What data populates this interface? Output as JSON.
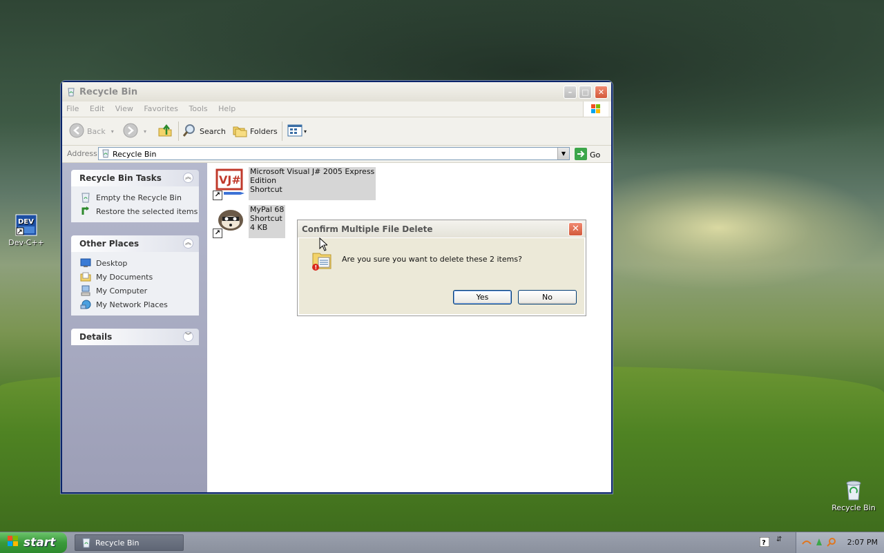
{
  "desktop": {
    "icons": [
      {
        "label": "Dev-C++",
        "icon": "devcpp-icon"
      },
      {
        "label": "Recycle Bin",
        "icon": "recycle-bin-icon"
      }
    ]
  },
  "window": {
    "title": "Recycle Bin",
    "menu": [
      "File",
      "Edit",
      "View",
      "Favorites",
      "Tools",
      "Help"
    ],
    "toolbar": {
      "back": "Back",
      "search": "Search",
      "folders": "Folders"
    },
    "address": {
      "label": "Address",
      "value": "Recycle Bin",
      "go": "Go"
    },
    "tasks_panel": {
      "title": "Recycle Bin Tasks",
      "items": [
        "Empty the Recycle Bin",
        "Restore the selected items"
      ]
    },
    "places_panel": {
      "title": "Other Places",
      "items": [
        "Desktop",
        "My Documents",
        "My Computer",
        "My Network Places"
      ]
    },
    "details_panel": {
      "title": "Details"
    },
    "files": [
      {
        "name_line1": "Microsoft Visual J# 2005 Express",
        "name_line2": "Edition",
        "type": "Shortcut",
        "size": ""
      },
      {
        "name_line1": "MyPal 68",
        "name_line2": "",
        "type": "Shortcut",
        "size": "4 KB"
      }
    ]
  },
  "dialog": {
    "title": "Confirm Multiple File Delete",
    "message": "Are you sure you want to delete these 2 items?",
    "yes": "Yes",
    "no": "No"
  },
  "taskbar": {
    "start": "start",
    "task": "Recycle Bin",
    "clock": "2:07 PM"
  },
  "colors": {
    "xp_blue": "#0a246a",
    "close_red": "#d3593a",
    "start_green": "#3a9a3a"
  }
}
